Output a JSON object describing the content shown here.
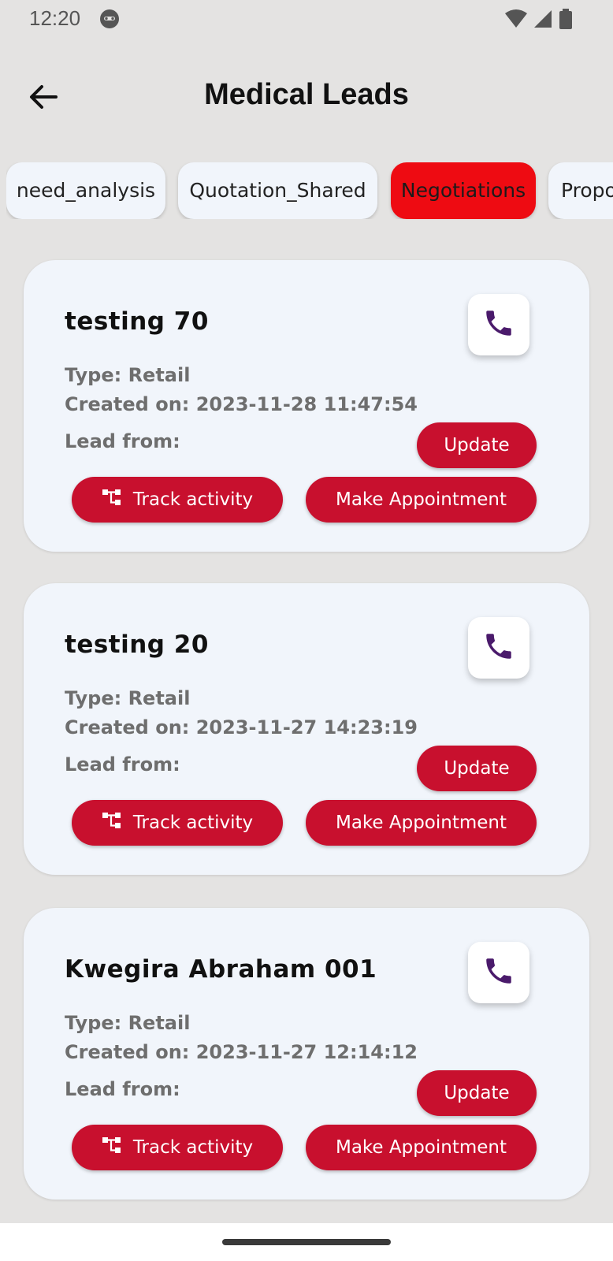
{
  "status_bar": {
    "time": "12:20"
  },
  "app_bar": {
    "title": "Medical Leads"
  },
  "chips": [
    {
      "label": "need_analysis",
      "active": false
    },
    {
      "label": "Quotation_Shared",
      "active": false
    },
    {
      "label": "Negotiations",
      "active": true
    },
    {
      "label": "Propo",
      "active": false
    }
  ],
  "leads": [
    {
      "name": "testing 70",
      "type": "Type: Retail",
      "created": "Created on: 2023-11-28 11:47:54",
      "lead_from": "Lead from:"
    },
    {
      "name": "testing 20",
      "type": "Type: Retail",
      "created": "Created on: 2023-11-27 14:23:19",
      "lead_from": "Lead from:"
    },
    {
      "name": "Kwegira Abraham 001",
      "type": "Type: Retail",
      "created": "Created on: 2023-11-27 12:14:12",
      "lead_from": "Lead from:"
    }
  ],
  "buttons": {
    "update": "Update",
    "track_activity": "Track activity",
    "make_appointment": "Make Appointment"
  },
  "colors": {
    "accent_red": "#c8102e",
    "active_chip": "#ee0b12",
    "phone_icon": "#4a1a6b",
    "card_bg": "#f1f5fb",
    "page_bg": "#e4e3e2"
  },
  "icons": {
    "back": "arrow-left-icon",
    "call": "phone-icon",
    "track": "flow-chart-icon"
  }
}
